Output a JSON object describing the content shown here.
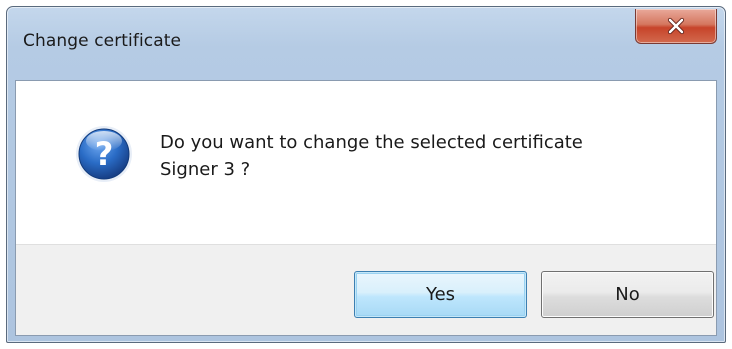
{
  "dialog": {
    "title": "Change certificate",
    "message_line1": "Do you want to change the selected certificate",
    "message_line2": "Signer 3 ?",
    "buttons": {
      "yes_label": "Yes",
      "no_label": "No"
    },
    "icons": {
      "message_icon": "question-icon",
      "close_icon": "close-icon"
    },
    "colors": {
      "title_bar": "#b5cbe4",
      "close_button": "#c7442a",
      "question_icon": "#1f5fb8",
      "default_button_border": "#3c7fb1",
      "button_panel": "#f0f0f0"
    }
  }
}
